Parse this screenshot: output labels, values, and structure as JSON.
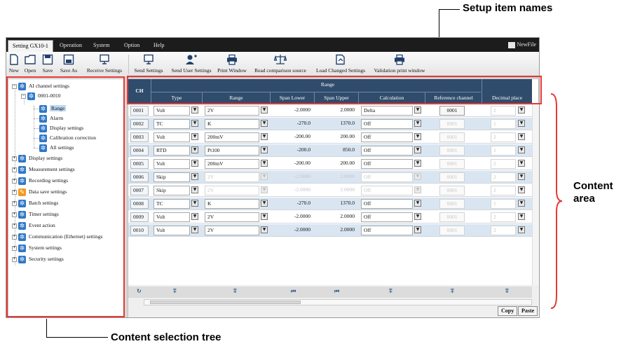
{
  "callouts": {
    "setup_item_names": "Setup item names",
    "content_area": "Content\narea",
    "content_area_line1": "Content",
    "content_area_line2": "area",
    "content_selection_tree": "Content selection tree"
  },
  "tabs": [
    {
      "label": "Setting GX10-1",
      "active": true
    },
    {
      "label": "Operation"
    },
    {
      "label": "System"
    },
    {
      "label": "Option"
    },
    {
      "label": "Help"
    }
  ],
  "newfile_label": "NewFile",
  "toolbar": [
    {
      "label": "New",
      "icon": "new-file-icon"
    },
    {
      "label": "Open",
      "icon": "open-folder-icon"
    },
    {
      "label": "Save",
      "icon": "save-icon"
    },
    {
      "label": "Save As",
      "icon": "save-as-icon"
    },
    {
      "label": "Receive Settings",
      "icon": "receive-settings-icon"
    },
    {
      "label": "Send Settings",
      "icon": "send-settings-icon"
    },
    {
      "label": "Send User Settings",
      "icon": "send-user-settings-icon"
    },
    {
      "label": "Print Window",
      "icon": "print-icon"
    },
    {
      "label": "Read comparison source",
      "icon": "scale-icon"
    },
    {
      "label": "Load Changed Settings",
      "icon": "load-changed-icon"
    },
    {
      "label": "Validation print window",
      "icon": "validation-print-icon"
    }
  ],
  "tree": [
    {
      "label": "AI channel settings",
      "level": 0,
      "expander": "-"
    },
    {
      "label": "0001-0010",
      "level": 1,
      "expander": "-"
    },
    {
      "label": "Range",
      "level": 2,
      "selected": true
    },
    {
      "label": "Alarm",
      "level": 2
    },
    {
      "label": "Display settings",
      "level": 2
    },
    {
      "label": "Calibration correction",
      "level": 2
    },
    {
      "label": "All settings",
      "level": 2
    },
    {
      "label": "Display settings",
      "level": 0,
      "expander": "+"
    },
    {
      "label": "Measurement settings",
      "level": 0,
      "expander": "+"
    },
    {
      "label": "Recording settings",
      "level": 0,
      "expander": "+"
    },
    {
      "label": "Data save settings",
      "level": 0,
      "expander": "+"
    },
    {
      "label": "Batch settings",
      "level": 0,
      "expander": "+"
    },
    {
      "label": "Timer settings",
      "level": 0,
      "expander": "+"
    },
    {
      "label": "Event action",
      "level": 0,
      "expander": "+"
    },
    {
      "label": "Communication (Ethernet) settings",
      "level": 0,
      "expander": "+"
    },
    {
      "label": "System settings",
      "level": 0,
      "expander": "+"
    },
    {
      "label": "Security settings",
      "level": 0,
      "expander": "+"
    }
  ],
  "table": {
    "group_header": "Range",
    "columns": {
      "ch": "CH",
      "type": "Type",
      "range": "Range",
      "span_lower": "Span Lower",
      "span_upper": "Span Upper",
      "calculation": "Calculation",
      "reference_channel": "Reference channel",
      "decimal_place": "Decimal place"
    },
    "rows": [
      {
        "ch": "0001",
        "type": "Volt",
        "range": "2V",
        "lower": "-2.0000",
        "upper": "2.0000",
        "calc": "Delta",
        "ref": "0001",
        "dec": "2",
        "enabled": true,
        "ref_enabled": true
      },
      {
        "ch": "0002",
        "type": "TC",
        "range": "K",
        "lower": "-270.0",
        "upper": "1370.0",
        "calc": "Off",
        "ref": "0001",
        "dec": "1",
        "enabled": true,
        "ref_enabled": false
      },
      {
        "ch": "0003",
        "type": "Volt",
        "range": "200mV",
        "lower": "-200.00",
        "upper": "200.00",
        "calc": "Off",
        "ref": "0001",
        "dec": "2",
        "enabled": true,
        "ref_enabled": false
      },
      {
        "ch": "0004",
        "type": "RTD",
        "range": "Pt100",
        "lower": "-200.0",
        "upper": "850.0",
        "calc": "Off",
        "ref": "0001",
        "dec": "1",
        "enabled": true,
        "ref_enabled": false
      },
      {
        "ch": "0005",
        "type": "Volt",
        "range": "200mV",
        "lower": "-200.00",
        "upper": "200.00",
        "calc": "Off",
        "ref": "0001",
        "dec": "2",
        "enabled": true,
        "ref_enabled": false
      },
      {
        "ch": "0006",
        "type": "Skip",
        "range": "2V",
        "lower": "-2.0000",
        "upper": "2.0000",
        "calc": "Off",
        "ref": "0001",
        "dec": "2",
        "enabled": false,
        "ref_enabled": false
      },
      {
        "ch": "0007",
        "type": "Skip",
        "range": "2V",
        "lower": "-2.0000",
        "upper": "2.0000",
        "calc": "Off",
        "ref": "0001",
        "dec": "2",
        "enabled": false,
        "ref_enabled": false
      },
      {
        "ch": "0008",
        "type": "TC",
        "range": "K",
        "lower": "-270.0",
        "upper": "1370.0",
        "calc": "Off",
        "ref": "0001",
        "dec": "1",
        "enabled": true,
        "ref_enabled": false
      },
      {
        "ch": "0009",
        "type": "Volt",
        "range": "2V",
        "lower": "-2.0000",
        "upper": "2.0000",
        "calc": "Off",
        "ref": "0001",
        "dec": "2",
        "enabled": true,
        "ref_enabled": false
      },
      {
        "ch": "0010",
        "type": "Volt",
        "range": "2V",
        "lower": "-2.0000",
        "upper": "2.0000",
        "calc": "Off",
        "ref": "0001",
        "dec": "2",
        "enabled": true,
        "ref_enabled": false
      }
    ]
  },
  "footer": {
    "copy_label": "Copy",
    "paste_label": "Paste"
  },
  "colors": {
    "header_bg": "#2f4c6c",
    "alt_row": "#d9e6f1",
    "highlight": "#e53935",
    "tree_icon": "#2f78c6"
  }
}
